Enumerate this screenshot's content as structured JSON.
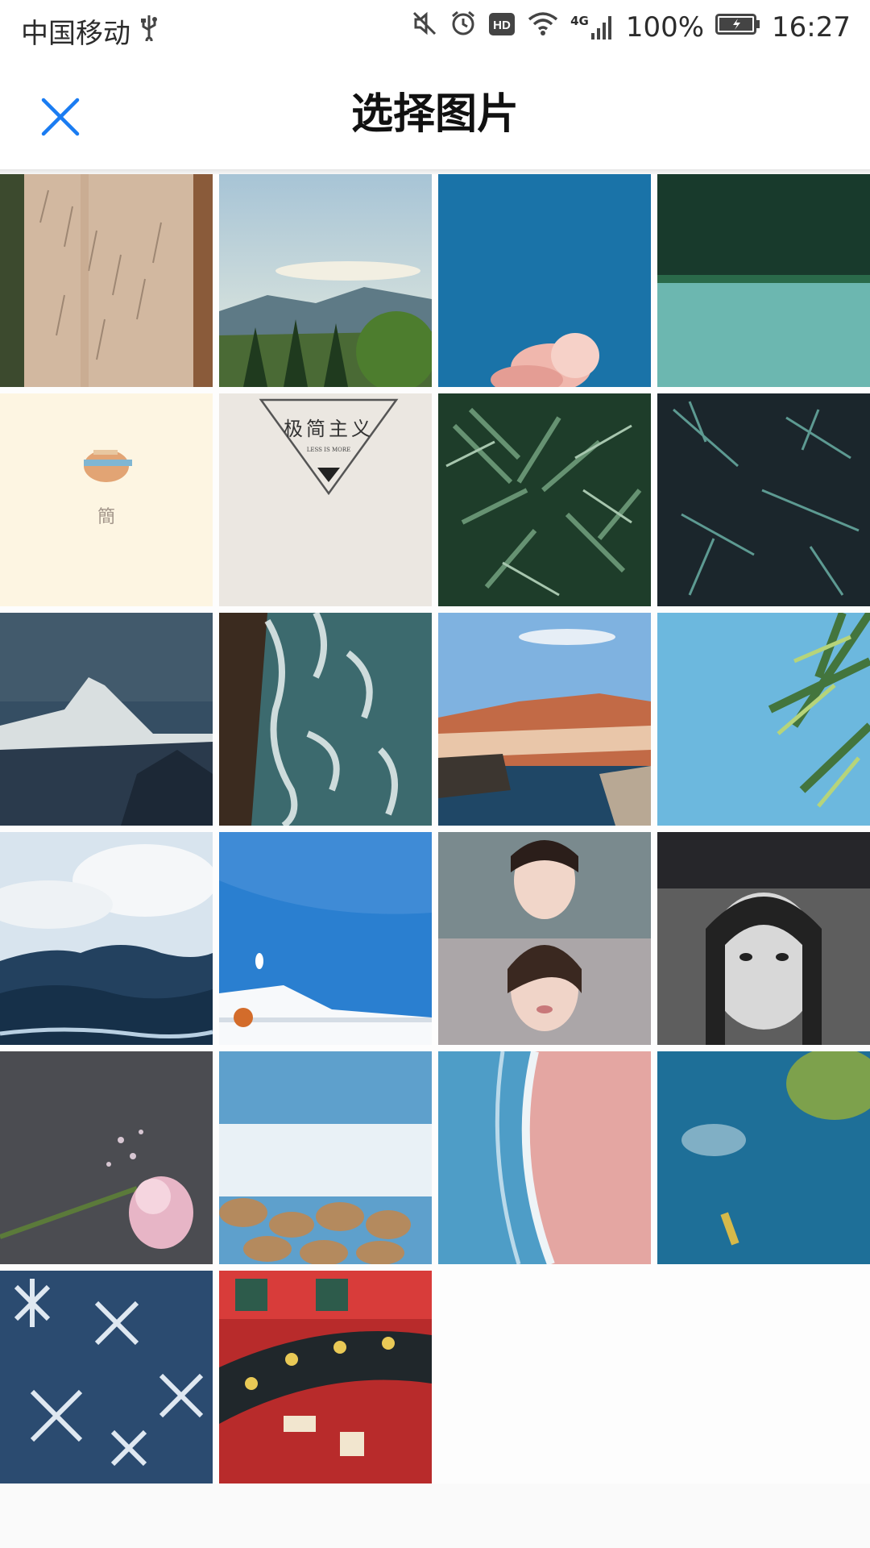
{
  "status_bar": {
    "carrier": "中国移动",
    "network": "4G",
    "battery": "100%",
    "time": "16:27",
    "icons": [
      "usb-icon",
      "mute-icon",
      "alarm-icon",
      "hd-icon",
      "wifi-icon",
      "signal-icon",
      "battery-icon"
    ]
  },
  "header": {
    "title": "选择图片",
    "close_icon": "close-icon"
  },
  "gallery": {
    "tiles": [
      {
        "name": "photo-aerial-road"
      },
      {
        "name": "photo-mountain-forest"
      },
      {
        "name": "photo-blue-sky-cloud"
      },
      {
        "name": "photo-lake-forest"
      },
      {
        "name": "photo-minimal-logo",
        "caption": "簡"
      },
      {
        "name": "photo-minimalism-poster",
        "caption": "极简主义",
        "subcaption": "LESS IS MORE"
      },
      {
        "name": "photo-green-fern"
      },
      {
        "name": "photo-dark-pine"
      },
      {
        "name": "photo-matterhorn"
      },
      {
        "name": "photo-sea-waves-aerial"
      },
      {
        "name": "photo-coastal-town"
      },
      {
        "name": "photo-tree-branches-sky"
      },
      {
        "name": "photo-ocean-waves-clouds"
      },
      {
        "name": "photo-blue-sea-boat"
      },
      {
        "name": "photo-woman-portrait-collage"
      },
      {
        "name": "photo-girl-bw-portrait"
      },
      {
        "name": "photo-flower-bouquet"
      },
      {
        "name": "photo-waves-pebbles"
      },
      {
        "name": "photo-pink-beach"
      },
      {
        "name": "photo-aerial-boat-forest"
      },
      {
        "name": "photo-frost-crystals"
      },
      {
        "name": "photo-chinese-temple"
      }
    ]
  }
}
